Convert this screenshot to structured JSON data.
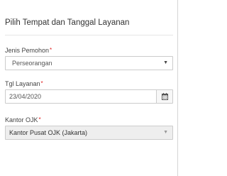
{
  "form": {
    "title": "Pilih Tempat dan Tanggal Layanan",
    "required_mark": "*",
    "jenis_pemohon": {
      "label": "Jenis Pemohon",
      "value": "Perseorangan"
    },
    "tgl_layanan": {
      "label": "Tgl Layanan",
      "value": "23/04/2020"
    },
    "kantor_ojk": {
      "label": "Kantor OJK",
      "value": "Kantor Pusat OJK (Jakarta)"
    }
  },
  "icons": {
    "dropdown": "chevron-down-icon",
    "date_picker": "calendar-icon"
  },
  "colors": {
    "required": "#e02020",
    "disabled_field": "#eeeeee"
  }
}
